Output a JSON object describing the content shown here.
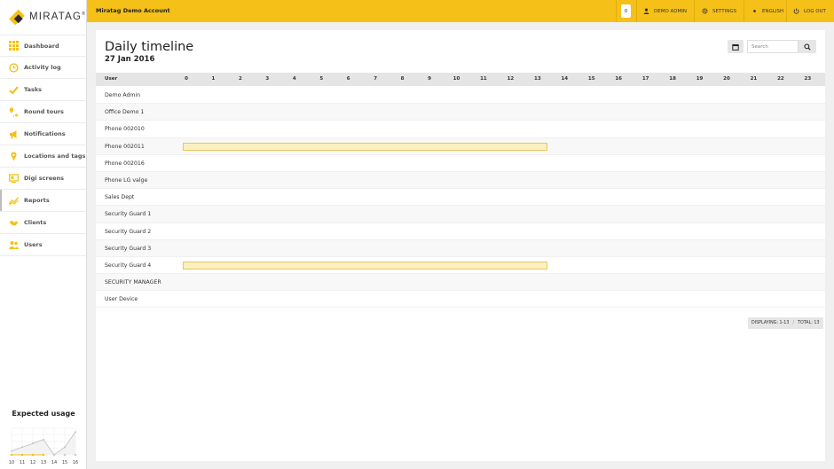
{
  "brand": {
    "name": "MIRATAG",
    "tm": "®"
  },
  "header": {
    "account": "Miratag Demo Account",
    "notifications_count": "0",
    "user": "DEMO ADMIN",
    "settings": "SETTINGS",
    "language": "ENGLISH",
    "logout": "LOG OUT"
  },
  "sidebar": {
    "items": [
      {
        "label": "Dashboard",
        "icon": "grid-icon"
      },
      {
        "label": "Activity log",
        "icon": "clock-icon"
      },
      {
        "label": "Tasks",
        "icon": "check-icon"
      },
      {
        "label": "Round tours",
        "icon": "route-pin-icon"
      },
      {
        "label": "Notifications",
        "icon": "megaphone-icon"
      },
      {
        "label": "Locations and tags",
        "icon": "location-pin-icon"
      },
      {
        "label": "Digi screens",
        "icon": "screen-icon"
      },
      {
        "label": "Reports",
        "icon": "trend-chart-icon"
      },
      {
        "label": "Clients",
        "icon": "handshake-icon"
      },
      {
        "label": "Users",
        "icon": "users-icon"
      }
    ],
    "active_index": 7
  },
  "usage": {
    "title": "Expected usage",
    "chart_data": {
      "type": "line",
      "x": [
        "10",
        "11",
        "12",
        "13",
        "14",
        "15",
        "16"
      ],
      "series": [
        {
          "values": [
            1,
            2,
            3,
            4,
            0,
            2,
            6
          ]
        }
      ],
      "ylim": [
        0,
        7
      ],
      "grid": true,
      "accent": "#f5c118",
      "line_color": "#c9c9c9"
    }
  },
  "page": {
    "title": "Daily timeline",
    "date": "27 Jan 2016",
    "search_placeholder": "Search"
  },
  "timeline": {
    "user_header": "User",
    "hours": [
      "0",
      "1",
      "2",
      "3",
      "4",
      "5",
      "6",
      "7",
      "8",
      "9",
      "10",
      "11",
      "12",
      "13",
      "14",
      "15",
      "16",
      "17",
      "18",
      "19",
      "20",
      "21",
      "22",
      "23"
    ],
    "rows": [
      {
        "name": "Demo Admin",
        "spans": []
      },
      {
        "name": "Office Demo 1",
        "spans": []
      },
      {
        "name": "Phone 002010",
        "spans": []
      },
      {
        "name": "Phone 002011",
        "spans": [
          [
            0,
            13.5
          ]
        ]
      },
      {
        "name": "Phone 002016",
        "spans": []
      },
      {
        "name": "Phone LG valge",
        "spans": []
      },
      {
        "name": "Sales Dept",
        "spans": []
      },
      {
        "name": "Security Guard 1",
        "spans": []
      },
      {
        "name": "Security Guard 2",
        "spans": []
      },
      {
        "name": "Security Guard 3",
        "spans": []
      },
      {
        "name": "Security Guard 4",
        "spans": [
          [
            0,
            13.5
          ]
        ]
      },
      {
        "name": "SECURITY MANAGER",
        "spans": []
      },
      {
        "name": "User Device",
        "spans": []
      }
    ],
    "bar_fill": "#fcf0c0",
    "bar_border": "#e9c65e"
  },
  "pager": {
    "displaying": "DISPLAYING: 1-13",
    "total": "TOTAL: 13"
  },
  "colors": {
    "accent": "#f5c118"
  }
}
